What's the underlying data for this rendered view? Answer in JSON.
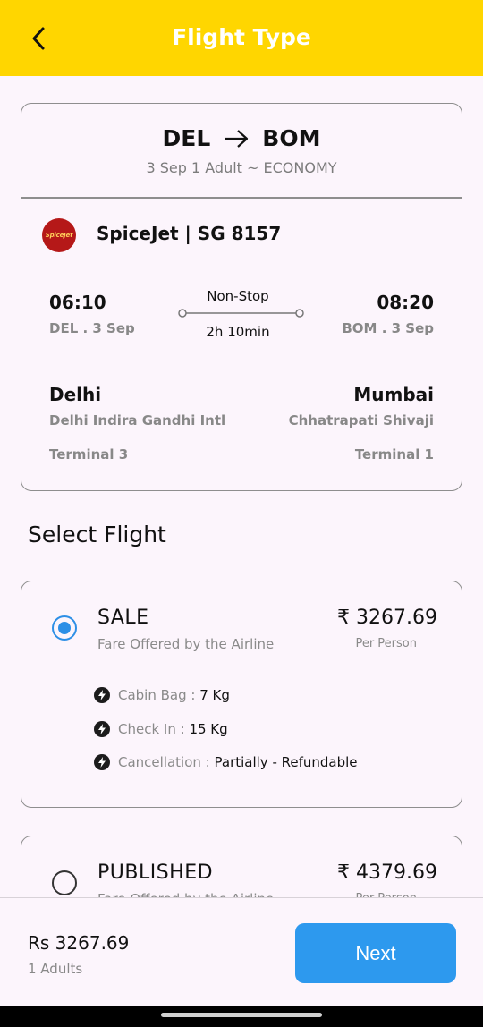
{
  "header": {
    "title": "Flight Type",
    "back_icon": "arrow-back-icon"
  },
  "summary": {
    "from": "DEL",
    "to": "BOM",
    "trip_meta": "3 Sep 1 Adult ~ ECONOMY",
    "airline": {
      "logo_text": "SpiceJet",
      "name": "SpiceJet | SG 8157",
      "logo_color": "#b51818"
    },
    "departure": {
      "time": "06:10",
      "date": "DEL . 3 Sep",
      "city": "Delhi",
      "airport": "Delhi Indira Gandhi Intl",
      "terminal": "Terminal 3"
    },
    "arrival": {
      "time": "08:20",
      "date": "BOM . 3 Sep",
      "city": "Mumbai",
      "airport": "Chhatrapati Shivaji",
      "terminal": "Terminal 1"
    },
    "stops": "Non-Stop",
    "duration": "2h 10min"
  },
  "select_flight": {
    "title": "Select Flight",
    "fares": [
      {
        "name": "SALE",
        "subtitle": "Fare Offered by the Airline",
        "price": "₹ 3267.69",
        "per": "Per Person",
        "selected": true,
        "benefits": [
          {
            "label": "Cabin Bag : ",
            "value": "7 Kg"
          },
          {
            "label": "Check In : ",
            "value": "15 Kg"
          },
          {
            "label": "Cancellation : ",
            "value": "Partially - Refundable"
          }
        ]
      },
      {
        "name": "PUBLISHED",
        "subtitle": "Fare Offered by the Airline",
        "price": "₹ 4379.69",
        "per": "Per Person",
        "selected": false
      }
    ]
  },
  "footer": {
    "total": "Rs 3267.69",
    "adults": "1 Adults",
    "next_label": "Next"
  },
  "colors": {
    "header": "#ffd600",
    "accent": "#2d99ee",
    "background": "#fcf5fc"
  }
}
